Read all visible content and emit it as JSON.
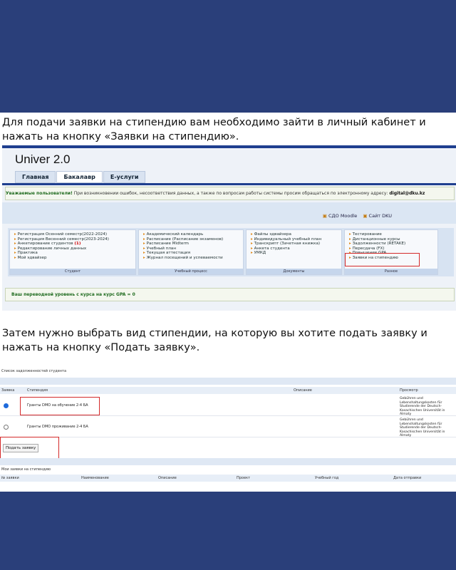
{
  "instruction1": {
    "line1": "Для подачи заявки на стипендию вам необходимо зайти в личный кабинет и",
    "line2": "нажать на кнопку «Заявки на стипендию»."
  },
  "instruction2": {
    "line1": "Затем нужно выбрать вид стипендии, на которую вы хотите подать заявку и",
    "line2": "нажать на кнопку «Подать заявку»."
  },
  "univer": {
    "brand": "Univer 2.0",
    "tabs": [
      "Главная",
      "Бакалавр",
      "E-услуги"
    ],
    "notice_bold": "Уважаемые пользователи!",
    "notice_text": " При возникновении ошибок, несоответствия данных, а также по вопросам работы системы просим обращаться по электронному адресу: ",
    "notice_email": "digital@dku.kz",
    "top_links": [
      "СДО Moodle",
      "Сайт DKU"
    ],
    "columns": [
      {
        "caption": "Студент",
        "items": [
          "Регистрация Осенний семестр(2022-2024)",
          "Регистрация Весенний семестр(2023-2024)",
          "Анкетирование студентов",
          "Редактирование личных данных",
          "Практика",
          "Мой эдвайзер"
        ],
        "count": "(1)"
      },
      {
        "caption": "Учебный процесс",
        "items": [
          "Академический календарь",
          "Расписание (Расписание экзаменов)",
          "Расписание Midterm",
          "Учебный план",
          "Текущая аттестация",
          "Журнал посещений и успеваемости"
        ]
      },
      {
        "caption": "Документы",
        "items": [
          "Файлы эдвайзера",
          "Индивидуальный учебный план",
          "Транскрипт (Зачетная книжка)",
          "Анкета студента",
          "УМКД"
        ]
      },
      {
        "caption": "Разное",
        "items": [
          "Тестирование",
          "Дистанционные курсы",
          "Задолженности (RETAKE)",
          "Пересдача (FX)",
          "Повышение GPA",
          "Заявки на стипендию"
        ]
      }
    ],
    "gpa_notice": "Ваш переводной уровень с курса на курс GPA = 0"
  },
  "scholarship": {
    "title": "Список задолженностей студента",
    "headers": [
      "Заявка",
      "Стипендия",
      "Описание",
      "Просмотр"
    ],
    "rows": [
      {
        "name": "Гранты DMO на обучение 2-4 БА",
        "provider": "Gebühren und Lebenshaltungskosten für Studierende der Deutsch-Kasachischen Universität in Almaty",
        "selected": true
      },
      {
        "name": "Гранты DMO проживание 2-4 БА",
        "provider": "Gebühren und Lebenshaltungskosten für Studierende der Deutsch-Kasachischen Universität in Almaty",
        "selected": false
      }
    ],
    "submit_label": "Подать заявку",
    "my_apps_title": "Мои заявки на стипендию",
    "my_apps_headers": [
      "№ заявки",
      "Наименование",
      "Описание",
      "Проект",
      "Учебный год",
      "Дата отправки"
    ]
  },
  "colors": {
    "background": "#2a3f7a",
    "highlight": "#d42a2a",
    "accent": "#1f3f8f"
  }
}
